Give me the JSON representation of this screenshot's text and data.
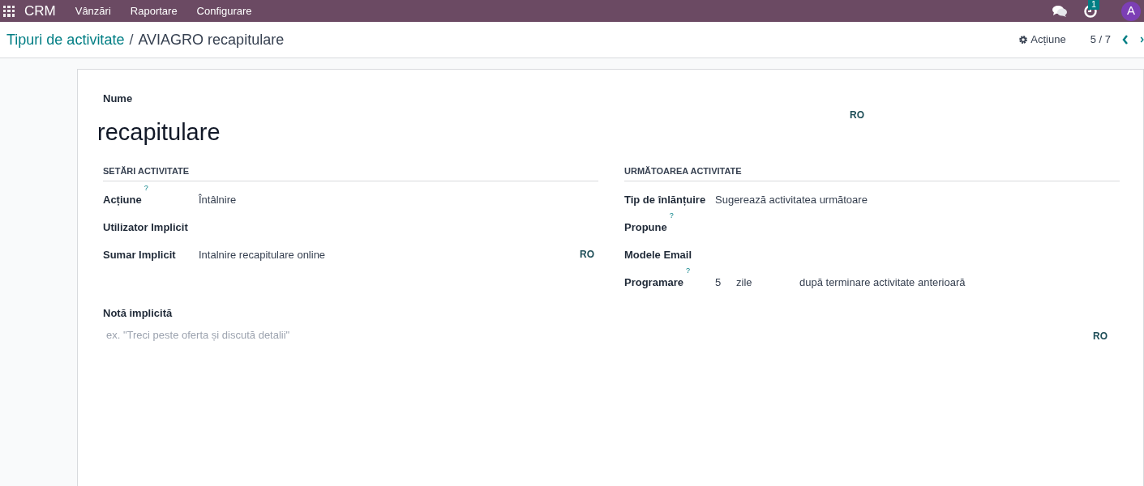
{
  "navbar": {
    "app": "CRM",
    "menus": [
      "Vânzări",
      "Raportare",
      "Configurare"
    ],
    "activity_badge": "1",
    "avatar": "A"
  },
  "breadcrumb": {
    "parent": "Tipuri de activitate",
    "separator": "/",
    "current": "AVIAGRO recapitulare"
  },
  "control_panel": {
    "action": "Acțiune",
    "pager": "5 / 7"
  },
  "form": {
    "name_label": "Nume",
    "name_value": "recapitulare",
    "name_lang": "RO",
    "left_group": {
      "title": "SETĂRI ACTIVITATE",
      "fields": [
        {
          "label": "Acțiune",
          "help": "?",
          "value": "Întâlnire"
        },
        {
          "label": "Utilizator Implicit"
        },
        {
          "label": "Sumar Implicit",
          "value": "Intalnire recapitulare online",
          "lang": "RO"
        }
      ]
    },
    "right_group": {
      "title": "URMĂTOAREA ACTIVITATE",
      "fields": [
        {
          "label": "Tip de înlănțuire",
          "value": "Sugerează activitatea următoare"
        },
        {
          "label": "Propune",
          "help": "?"
        },
        {
          "label": "Modele Email"
        },
        {
          "label": "Programare",
          "help": "?",
          "parts": [
            "5",
            "zile",
            "după terminare activitate anterioară"
          ]
        }
      ]
    },
    "note": {
      "label": "Notă implicită",
      "placeholder": "ex. \"Treci peste oferta și discută detalii\"",
      "lang": "RO"
    }
  }
}
